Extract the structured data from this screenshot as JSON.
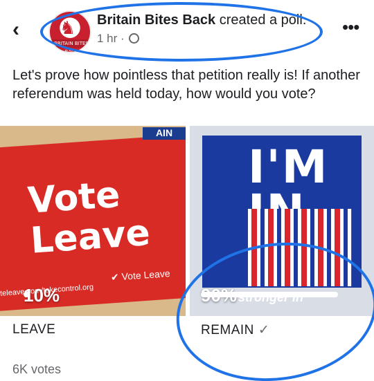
{
  "header": {
    "author_name": "Britain Bites Back",
    "action_text": "created a poll.",
    "time": "1 hr",
    "separator": "·",
    "avatar_band_text": "BRITAIN BITES BACK"
  },
  "post": {
    "text": "Let's prove how pointless that petition really is! If another referendum was held today, how would you vote?"
  },
  "poll": {
    "options": [
      {
        "label": "LEAVE",
        "percent": 10,
        "percent_label": "10%",
        "selected": false,
        "image_text": {
          "main": "Vote Leave",
          "logo": "Vote Leave",
          "url": "teleave.com/takecontrol.org"
        }
      },
      {
        "label": "REMAIN",
        "percent": 90,
        "percent_label": "90%",
        "selected": true,
        "image_text": {
          "main": "I'M IN",
          "sub": "stronger in"
        }
      }
    ],
    "votes": "6K votes",
    "check_glyph": "✓"
  },
  "icons": {
    "back": "chevron-left-icon",
    "more": "more-dots-icon",
    "privacy": "globe-icon"
  },
  "colors": {
    "annotation_blue": "#1f73e6",
    "leave_red": "#d92b25",
    "remain_blue": "#1a3aa0"
  }
}
